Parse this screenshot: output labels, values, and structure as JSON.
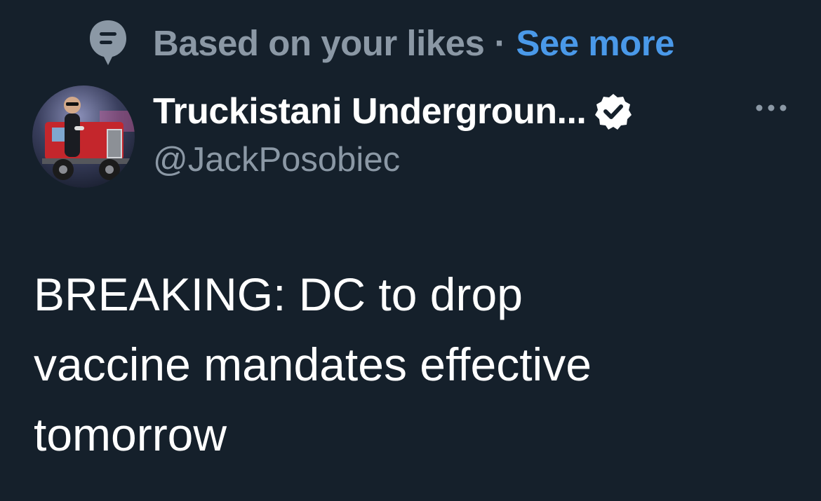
{
  "context": {
    "icon": "message-heart-icon",
    "label": "Based on your likes",
    "separator": "·",
    "link": "See more"
  },
  "author": {
    "avatar": "avatar-photo",
    "name": "Truckistani Undergroun...",
    "verified_icon": "verified-badge-icon",
    "handle": "@JackPosobiec"
  },
  "actions": {
    "more_icon": "more-dots-icon"
  },
  "tweet": {
    "line1": "BREAKING: DC to drop",
    "line2": "vaccine mandates effective",
    "line3": "tomorrow"
  },
  "colors": {
    "background": "#15202b",
    "secondary_text": "#8b98a5",
    "link": "#4a99e9",
    "primary_text": "#ffffff"
  }
}
